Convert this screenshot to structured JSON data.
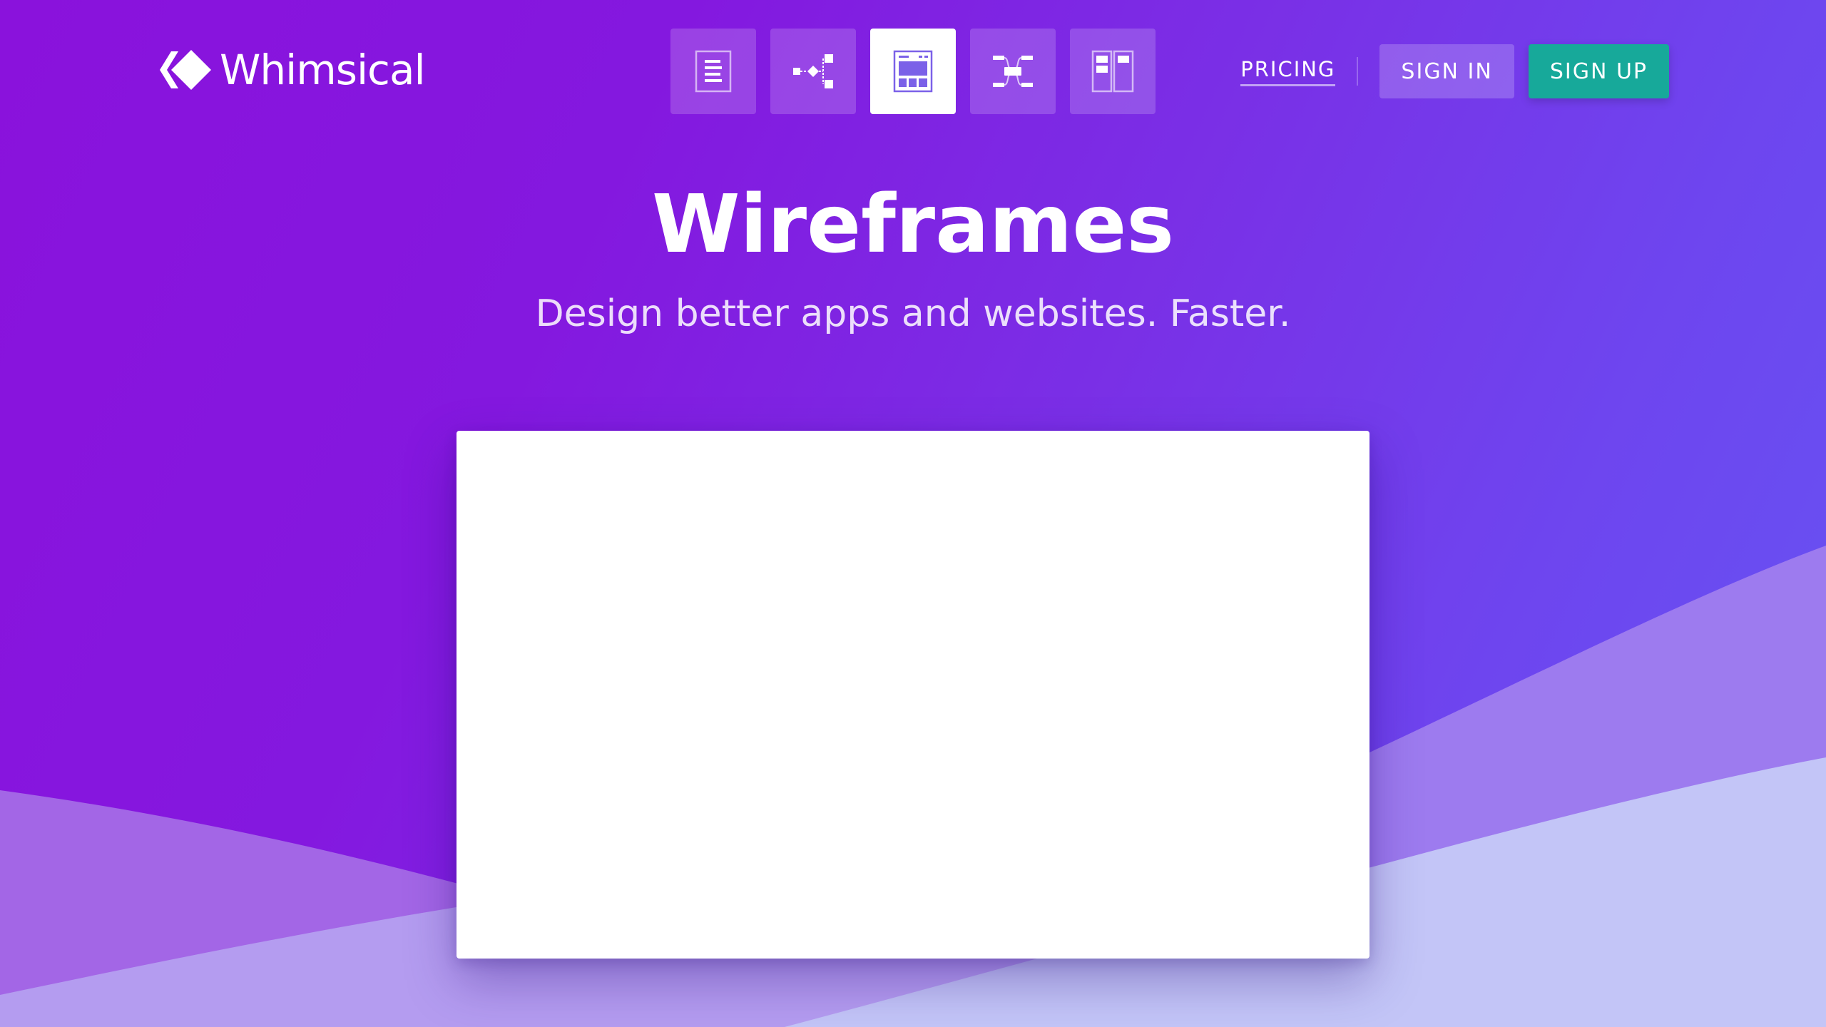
{
  "header": {
    "logo_text": "Whimsical",
    "tools": [
      {
        "icon": "docs-icon",
        "active": false
      },
      {
        "icon": "flowchart-icon",
        "active": false
      },
      {
        "icon": "wireframe-icon",
        "active": true
      },
      {
        "icon": "mindmap-icon",
        "active": false
      },
      {
        "icon": "board-icon",
        "active": false
      }
    ],
    "pricing_label": "PRICING",
    "signin_label": "SIGN IN",
    "signup_label": "SIGN UP"
  },
  "hero": {
    "title": "Wireframes",
    "subtitle": "Design better apps and websites. Faster."
  },
  "colors": {
    "background_start": "#8a12dc",
    "background_end": "#6555f3",
    "signup_button": "#17a99a",
    "active_tool_icon": "#7b61e8"
  }
}
